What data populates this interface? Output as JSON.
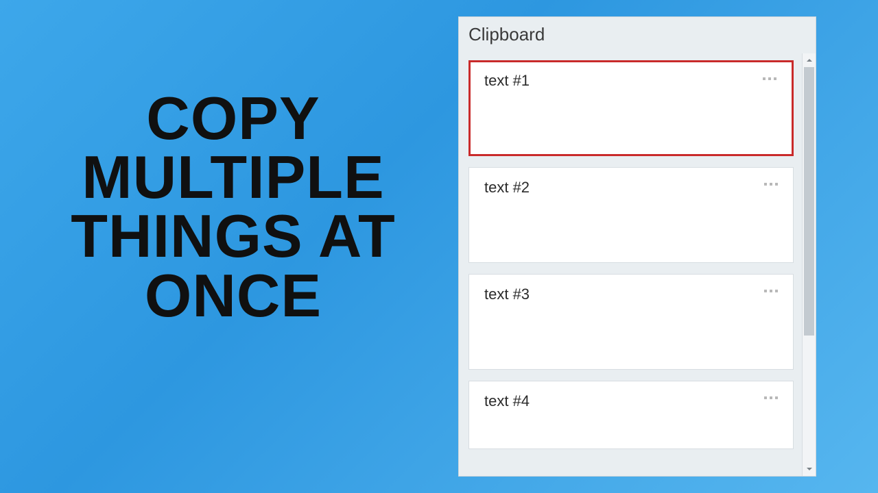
{
  "headline": "COPY\nMULTIPLE\nTHINGS AT\nONCE",
  "panel": {
    "title": "Clipboard",
    "items": [
      {
        "text": "text #1",
        "selected": true
      },
      {
        "text": "text #2",
        "selected": false
      },
      {
        "text": "text #3",
        "selected": false
      },
      {
        "text": "text #4",
        "selected": false
      }
    ]
  },
  "colors": {
    "selection_border": "#c92a2a",
    "panel_bg": "#e9eef1",
    "item_bg": "#ffffff"
  }
}
